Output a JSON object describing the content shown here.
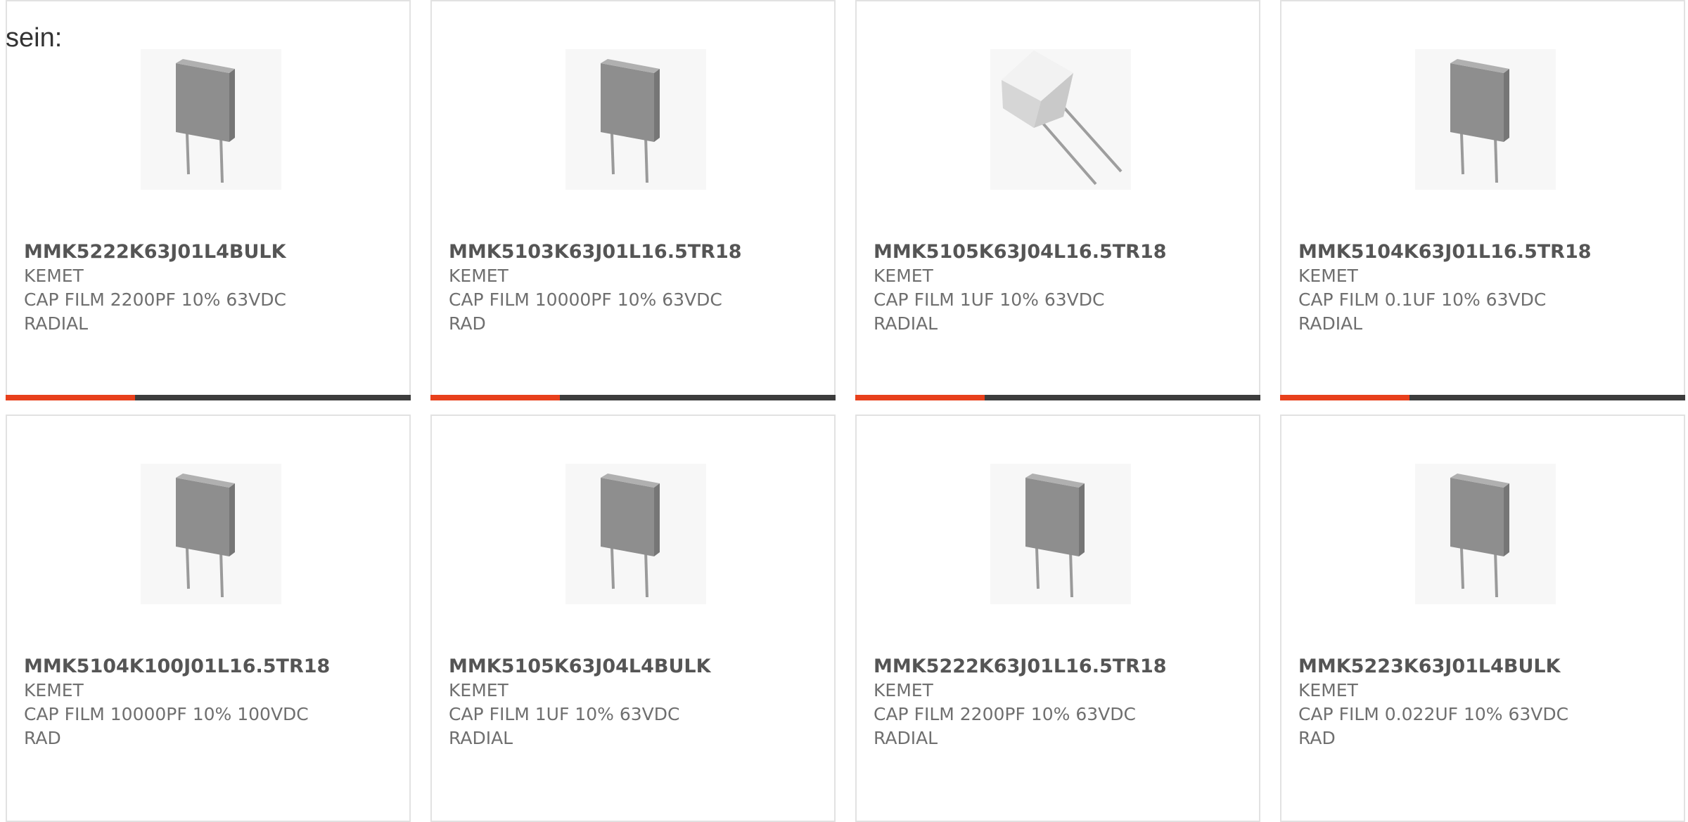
{
  "heading": "sein:",
  "accent_color": "#e8401c",
  "products": [
    {
      "part": "MMK5222K63J01L4BULK",
      "manufacturer": "KEMET",
      "desc1": "CAP FILM 2200PF 10% 63VDC",
      "desc2": "RADIAL",
      "icon": "box-capacitor-icon"
    },
    {
      "part": "MMK5103K63J01L16.5TR18",
      "manufacturer": "KEMET",
      "desc1": "CAP FILM 10000PF 10% 63VDC",
      "desc2": "RAD",
      "icon": "box-capacitor-icon"
    },
    {
      "part": "MMK5105K63J04L16.5TR18",
      "manufacturer": "KEMET",
      "desc1": "CAP FILM 1UF 10% 63VDC",
      "desc2": "RADIAL",
      "icon": "box-capacitor-tilted-icon"
    },
    {
      "part": "MMK5104K63J01L16.5TR18",
      "manufacturer": "KEMET",
      "desc1": "CAP FILM 0.1UF 10% 63VDC",
      "desc2": "RADIAL",
      "icon": "box-capacitor-icon"
    },
    {
      "part": "MMK5104K100J01L16.5TR18",
      "manufacturer": "KEMET",
      "desc1": "CAP FILM 10000PF 10% 100VDC",
      "desc2": "RAD",
      "icon": "box-capacitor-icon"
    },
    {
      "part": "MMK5105K63J04L4BULK",
      "manufacturer": "KEMET",
      "desc1": "CAP FILM 1UF 10% 63VDC",
      "desc2": "RADIAL",
      "icon": "box-capacitor-icon"
    },
    {
      "part": "MMK5222K63J01L16.5TR18",
      "manufacturer": "KEMET",
      "desc1": "CAP FILM 2200PF 10% 63VDC",
      "desc2": "RADIAL",
      "icon": "box-capacitor-icon"
    },
    {
      "part": "MMK5223K63J01L4BULK",
      "manufacturer": "KEMET",
      "desc1": "CAP FILM 0.022UF 10% 63VDC",
      "desc2": "RAD",
      "icon": "box-capacitor-icon"
    }
  ]
}
